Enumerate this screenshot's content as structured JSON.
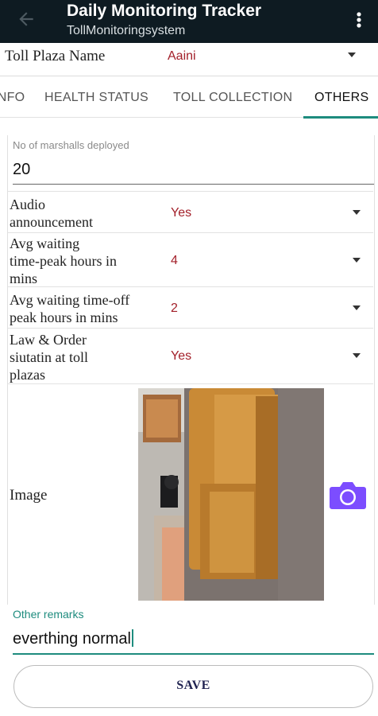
{
  "app_bar": {
    "title": "Daily Monitoring Tracker",
    "subtitle": "TollMonitoringsystem",
    "background_color": "#0e1b22",
    "back_icon": "arrow-left-icon",
    "menu_icon": "more-vertical-icon"
  },
  "plaza": {
    "label": "Toll Plaza Name",
    "value": "Aaini"
  },
  "tabs": [
    {
      "label": "INFO",
      "active": false
    },
    {
      "label": "HEALTH STATUS",
      "active": false
    },
    {
      "label": "TOLL COLLECTION",
      "active": false
    },
    {
      "label": "OTHERS",
      "active": true
    }
  ],
  "form": {
    "marshalls": {
      "label": "No of marshalls deployed",
      "value": "20"
    },
    "audio": {
      "label_lines": [
        "Audio",
        "announcement"
      ],
      "value": "Yes"
    },
    "peak_wait": {
      "label_lines": [
        "Avg waiting",
        "time-peak hours in",
        "mins"
      ],
      "value": "4"
    },
    "offpeak_wait": {
      "label_lines": [
        "Avg waiting time-off",
        "peak hours in mins"
      ],
      "value": "2"
    },
    "law_order": {
      "label_lines": [
        "Law & Order",
        "siutatin at toll",
        "plazas"
      ],
      "value": "Yes"
    },
    "image": {
      "label": "Image",
      "camera_icon": "camera-icon"
    },
    "remarks": {
      "label": "Other remarks",
      "value": "everthing normal"
    }
  },
  "save_button": {
    "label": "SAVE"
  },
  "colors": {
    "accent": "#1e8c7e",
    "value_text": "#a3202a",
    "camera": "#7c4dff",
    "save_text": "#1f2250"
  }
}
